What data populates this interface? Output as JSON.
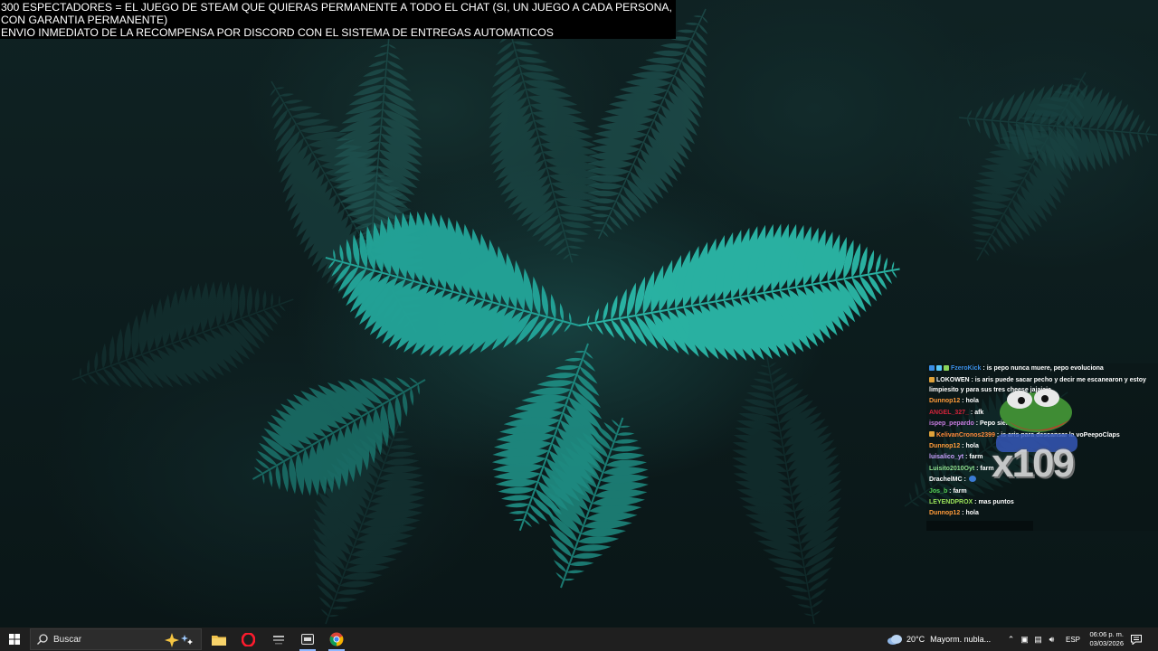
{
  "overlay": {
    "line1": "300 ESPECTADORES = EL JUEGO DE STEAM QUE QUIERAS PERMANENTE A TODO EL CHAT (SI, UN JUEGO A CADA PERSONA, CON GARANTIA PERMANENTE)",
    "line2": "ENVIO INMEDIATO DE LA RECOMPENSA POR DISCORD CON EL SISTEMA DE ENTREGAS AUTOMATICOS"
  },
  "chat": {
    "messages": [
      {
        "user": "FzeroKick",
        "color": "#3a8ee6",
        "text": ": is pepo nunca muere, pepo evoluciona"
      },
      {
        "user": "LOKOWEN",
        "color": "#ffffff",
        "text": ": is aris puede sacar pecho y decir me escanearon y estoy limpiesito y para sus tres cheese jajajaja"
      },
      {
        "user": "Dunnop12",
        "color": "#ff9b3a",
        "text": ": hola"
      },
      {
        "user": "ANGEL_327_",
        "color": "#d2243b",
        "text": ": afk"
      },
      {
        "user": "ispep_pepardo",
        "color": "#c77ce0",
        "text": ": Pepo siempre esta presente"
      },
      {
        "user": "KelivanCronos2399",
        "color": "#ff8a3a",
        "text": ": is aris para descansar la voPeepoClaps"
      },
      {
        "user": "Dunnop12",
        "color": "#ff9b3a",
        "text": ": hola"
      },
      {
        "user": "luisalico_yt",
        "color": "#c9a0ff",
        "text": ": farm"
      },
      {
        "user": "Luisito2010Oyt",
        "color": "#8fe08f",
        "text": ": farm"
      },
      {
        "user": "DrachelMC",
        "color": "#ffffff",
        "text": ":"
      },
      {
        "user": "Jos_b",
        "color": "#55d455",
        "text": ": farm"
      },
      {
        "user": "LEYENDPROX",
        "color": "#9be35a",
        "text": ": mas puntos"
      },
      {
        "user": "Dunnop12",
        "color": "#ff9b3a",
        "text": ": hola"
      }
    ],
    "combo": "x109"
  },
  "taskbar": {
    "search_placeholder": "Buscar",
    "weather_temp": "20°C",
    "weather_text": "Mayorm. nubla...",
    "language": "ESP",
    "time": "06:06 p. m.",
    "date": "03/03/2026"
  }
}
